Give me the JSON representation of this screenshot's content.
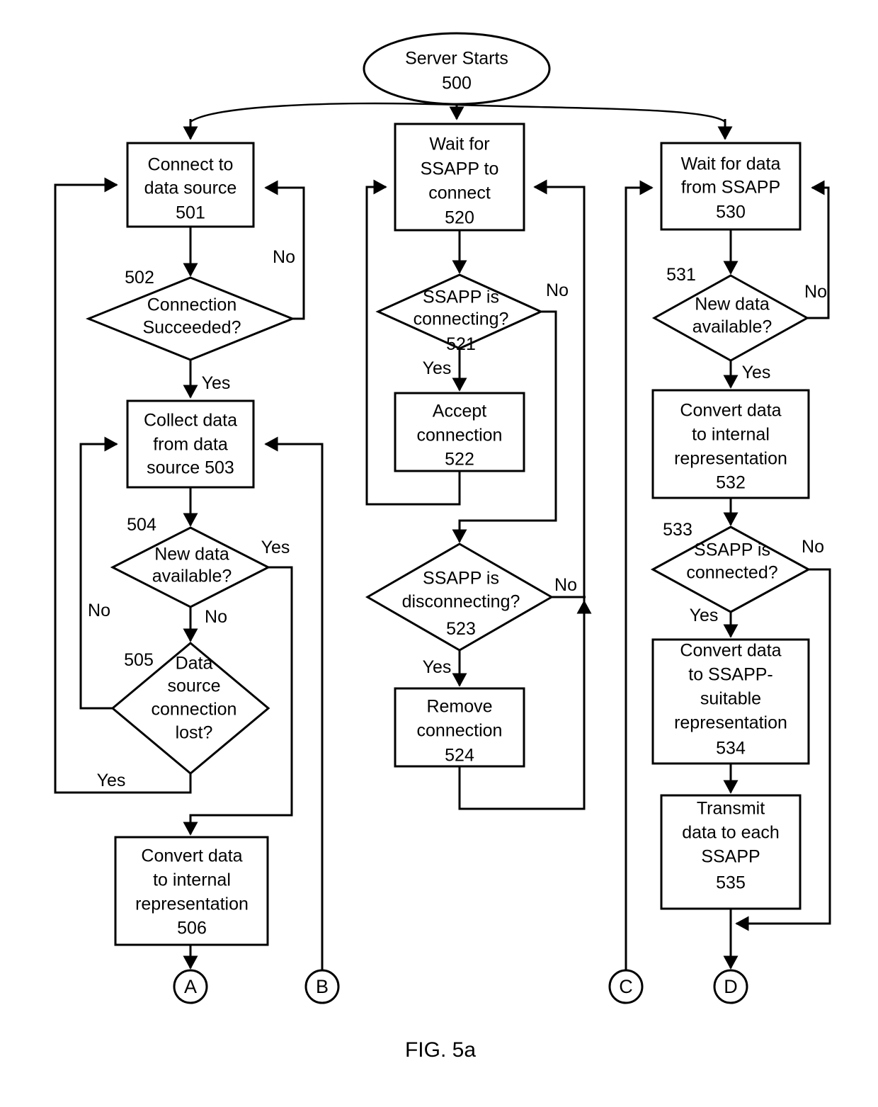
{
  "figure": {
    "caption": "FIG. 5a",
    "start_node": {
      "label": "Server Starts",
      "ref": "500"
    }
  },
  "columns": [
    {
      "name": "data-source-thread",
      "nodes": [
        {
          "id": "n501",
          "type": "process",
          "lines": [
            "Connect to",
            "data source"
          ],
          "ref": "501",
          "ref_inline": false
        },
        {
          "id": "n502",
          "type": "decision",
          "lines": [
            "Connection",
            "Succeeded?"
          ],
          "ref": "502"
        },
        {
          "id": "n503",
          "type": "process",
          "lines": [
            "Collect data",
            "from data",
            "source 503"
          ],
          "ref": "503",
          "ref_inline": true
        },
        {
          "id": "n504",
          "type": "decision",
          "lines": [
            "New data",
            "available?"
          ],
          "ref": "504"
        },
        {
          "id": "n505",
          "type": "decision",
          "lines": [
            "Data",
            "source",
            "connection",
            "lost?"
          ],
          "ref": "505"
        },
        {
          "id": "n506",
          "type": "process",
          "lines": [
            "Convert data",
            "to internal",
            "representation"
          ],
          "ref": "506",
          "ref_inline": false
        }
      ],
      "edge_labels": [
        "No",
        "Yes",
        "Yes",
        "No",
        "No",
        "Yes"
      ],
      "connector": "A"
    },
    {
      "name": "ssapp-connection-thread",
      "nodes": [
        {
          "id": "n520",
          "type": "process",
          "lines": [
            "Wait for",
            "SSAPP to",
            "connect"
          ],
          "ref": "520",
          "ref_inline": false
        },
        {
          "id": "n521",
          "type": "decision",
          "lines": [
            "SSAPP is",
            "connecting?"
          ],
          "ref": "521"
        },
        {
          "id": "n522",
          "type": "process",
          "lines": [
            "Accept",
            "connection"
          ],
          "ref": "522",
          "ref_inline": false
        },
        {
          "id": "n523",
          "type": "decision",
          "lines": [
            "SSAPP is",
            "disconnecting?"
          ],
          "ref": "523"
        },
        {
          "id": "n524",
          "type": "process",
          "lines": [
            "Remove",
            "connection"
          ],
          "ref": "524",
          "ref_inline": false
        }
      ],
      "edge_labels": [
        "No",
        "Yes",
        "No",
        "Yes"
      ],
      "connector": "B"
    },
    {
      "name": "ssapp-data-thread",
      "nodes": [
        {
          "id": "n530",
          "type": "process",
          "lines": [
            "Wait for data",
            "from SSAPP"
          ],
          "ref": "530",
          "ref_inline": false
        },
        {
          "id": "n531",
          "type": "decision",
          "lines": [
            "New data",
            "available?"
          ],
          "ref": "531"
        },
        {
          "id": "n532",
          "type": "process",
          "lines": [
            "Convert data",
            "to internal",
            "representation"
          ],
          "ref": "532",
          "ref_inline": false
        },
        {
          "id": "n533",
          "type": "decision",
          "lines": [
            "SSAPP is",
            "connected?"
          ],
          "ref": "533"
        },
        {
          "id": "n534",
          "type": "process",
          "lines": [
            "Convert data",
            "to SSAPP-",
            "suitable",
            "representation"
          ],
          "ref": "534",
          "ref_inline": false
        },
        {
          "id": "n535",
          "type": "process",
          "lines": [
            "Transmit",
            "data to each",
            "SSAPP"
          ],
          "ref": "535",
          "ref_inline": false
        }
      ],
      "edge_labels": [
        "No",
        "Yes",
        "No",
        "Yes"
      ],
      "connector_left": "C",
      "connector_right": "D"
    }
  ],
  "text": {
    "start_label": "Server Starts",
    "start_ref": "500",
    "n501_l1": "Connect to",
    "n501_l2": "data source",
    "n501_ref": "501",
    "n502_l1": "Connection",
    "n502_l2": "Succeeded?",
    "n502_ref": "502",
    "n502_no": "No",
    "n502_yes": "Yes",
    "n503_l1": "Collect data",
    "n503_l2": "from data",
    "n503_l3": "source 503",
    "n504_l1": "New data",
    "n504_l2": "available?",
    "n504_ref": "504",
    "n504_yes": "Yes",
    "n504_no": "No",
    "n505_l1": "Data",
    "n505_l2": "source",
    "n505_l3": "connection",
    "n505_l4": "lost?",
    "n505_ref": "505",
    "n505_no": "No",
    "n505_yes": "Yes",
    "n506_l1": "Convert data",
    "n506_l2": "to internal",
    "n506_l3": "representation",
    "n506_ref": "506",
    "conn_a": "A",
    "conn_b": "B",
    "n520_l1": "Wait for",
    "n520_l2": "SSAPP to",
    "n520_l3": "connect",
    "n520_ref": "520",
    "n521_l1": "SSAPP is",
    "n521_l2": "connecting?",
    "n521_ref": "521",
    "n521_no": "No",
    "n521_yes": "Yes",
    "n522_l1": "Accept",
    "n522_l2": "connection",
    "n522_ref": "522",
    "n523_l1": "SSAPP is",
    "n523_l2": "disconnecting?",
    "n523_ref": "523",
    "n523_no": "No",
    "n523_yes": "Yes",
    "n524_l1": "Remove",
    "n524_l2": "connection",
    "n524_ref": "524",
    "n530_l1": "Wait for data",
    "n530_l2": "from SSAPP",
    "n530_ref": "530",
    "n531_l1": "New data",
    "n531_l2": "available?",
    "n531_ref": "531",
    "n531_no": "No",
    "n531_yes": "Yes",
    "n532_l1": "Convert data",
    "n532_l2": "to internal",
    "n532_l3": "representation",
    "n532_ref": "532",
    "n533_l1": "SSAPP is",
    "n533_l2": "connected?",
    "n533_ref": "533",
    "n533_no": "No",
    "n533_yes": "Yes",
    "n534_l1": "Convert data",
    "n534_l2": "to SSAPP-",
    "n534_l3": "suitable",
    "n534_l4": "representation",
    "n534_ref": "534",
    "n535_l1": "Transmit",
    "n535_l2": "data to each",
    "n535_l3": "SSAPP",
    "n535_ref": "535",
    "conn_c": "C",
    "conn_d": "D",
    "caption": "FIG. 5a"
  },
  "colors": {
    "stroke": "#000000",
    "fill": "#ffffff",
    "text": "#000000"
  }
}
